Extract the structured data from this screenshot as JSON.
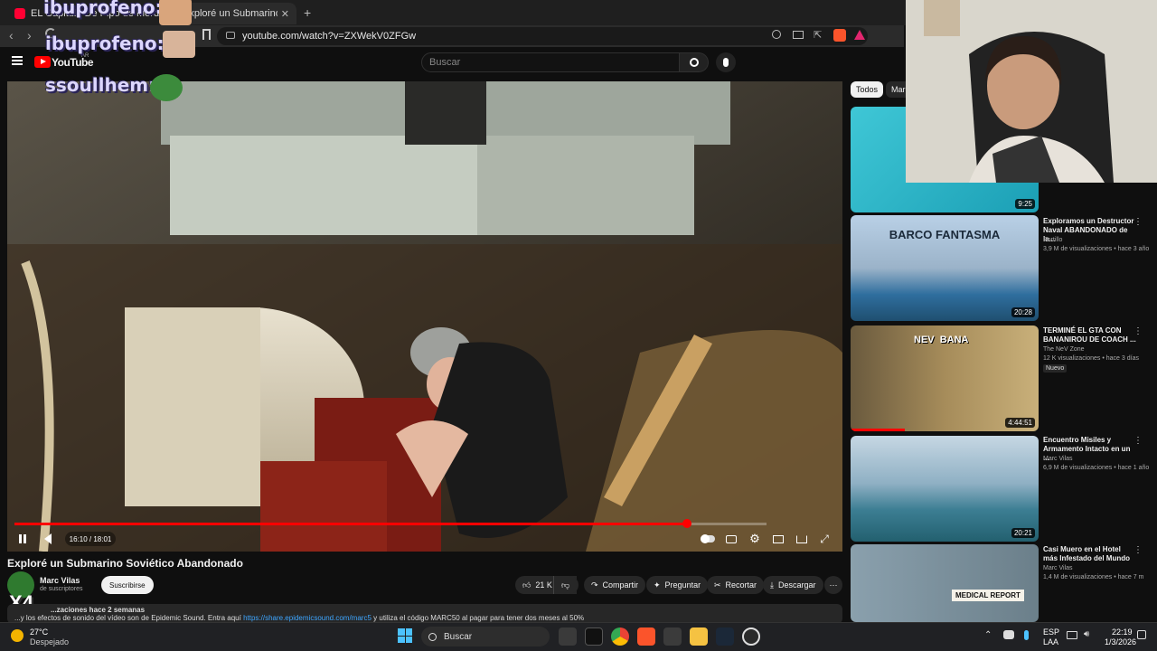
{
  "browser": {
    "tabs": [
      {
        "label": "EL Capitulo De Pipo de Mordidos F..."
      },
      {
        "label": "Exploré un Submarino Soviético..."
      }
    ],
    "new_tab": "+",
    "url": "youtube.com/watch?v=ZXWekV0ZFGw"
  },
  "header": {
    "logo": "YouTube",
    "logo_sup": "AR",
    "search_placeholder": "Buscar"
  },
  "overlays": {
    "chat_names": [
      "ibuprofeno:",
      "ibuprofeno:",
      "ssoullhem:"
    ],
    "x4": "X4"
  },
  "video": {
    "progress_fraction": 0.8948,
    "time": "16:10 / 18:01",
    "title": "Exploré un Submarino Soviético Abandonado"
  },
  "channel": {
    "name": "Marc Vilas",
    "subs": "de suscriptores",
    "subscribe": "Suscribirse"
  },
  "actions": {
    "likes": "21 K",
    "share": "Compartir",
    "ask": "Preguntar",
    "clip": "Recortar",
    "download": "Descargar"
  },
  "description": {
    "meta": "...zaciones  hace 2 semanas",
    "text": "...y los efectos de sonido del vídeo son de Epidemic Sound. Entra aquí",
    "link": "https://share.epidemicsound.com/marc5",
    "suffix": "y utiliza el código MARC50 al pagar para tener dos meses al 50%"
  },
  "chips": [
    "Todos",
    "Marc"
  ],
  "sidebar": [
    {
      "duration": "9:25",
      "title": "",
      "channel": "",
      "meta": "",
      "badge": ""
    },
    {
      "duration": "20:28",
      "thumb_text": "BARCO FANTASMA",
      "title": "Exploramos un Destructor Naval ABANDONADO de la...",
      "channel": "Portillo",
      "meta": "3,9 M de visualizaciones • hace 3 año",
      "badge": ""
    },
    {
      "duration": "4:44:51",
      "thumb_text": "NEV  BANA",
      "title": "TERMINÉ EL GTA CON BANANIROU DE COACH ...",
      "channel": "The NeV Zone",
      "meta": "12 K visualizaciones • hace 3 días",
      "badge": "Nuevo"
    },
    {
      "duration": "20:21",
      "title": "Encuentro Misiles y Armamento Intacto en un ...",
      "channel": "Marc Vilas",
      "meta": "6,9 M de visualizaciones • hace 1 año",
      "badge": ""
    },
    {
      "duration": "",
      "thumb_text": "MEDICAL REPORT",
      "title": "Casi Muero en el Hotel más Infestado del Mundo",
      "channel": "Marc Vilas",
      "meta": "1,4 M de visualizaciones • hace 7 m",
      "badge": ""
    }
  ],
  "taskbar": {
    "weather_temp": "27°C",
    "weather_desc": "Despejado",
    "search": "Buscar",
    "lang1": "ESP",
    "lang2": "LAA",
    "time": "22:19",
    "date": "1/3/2026"
  },
  "colors": {
    "accent": "#ff0000",
    "bg": "#0f0f0f",
    "chat": "#dcd6ff"
  }
}
